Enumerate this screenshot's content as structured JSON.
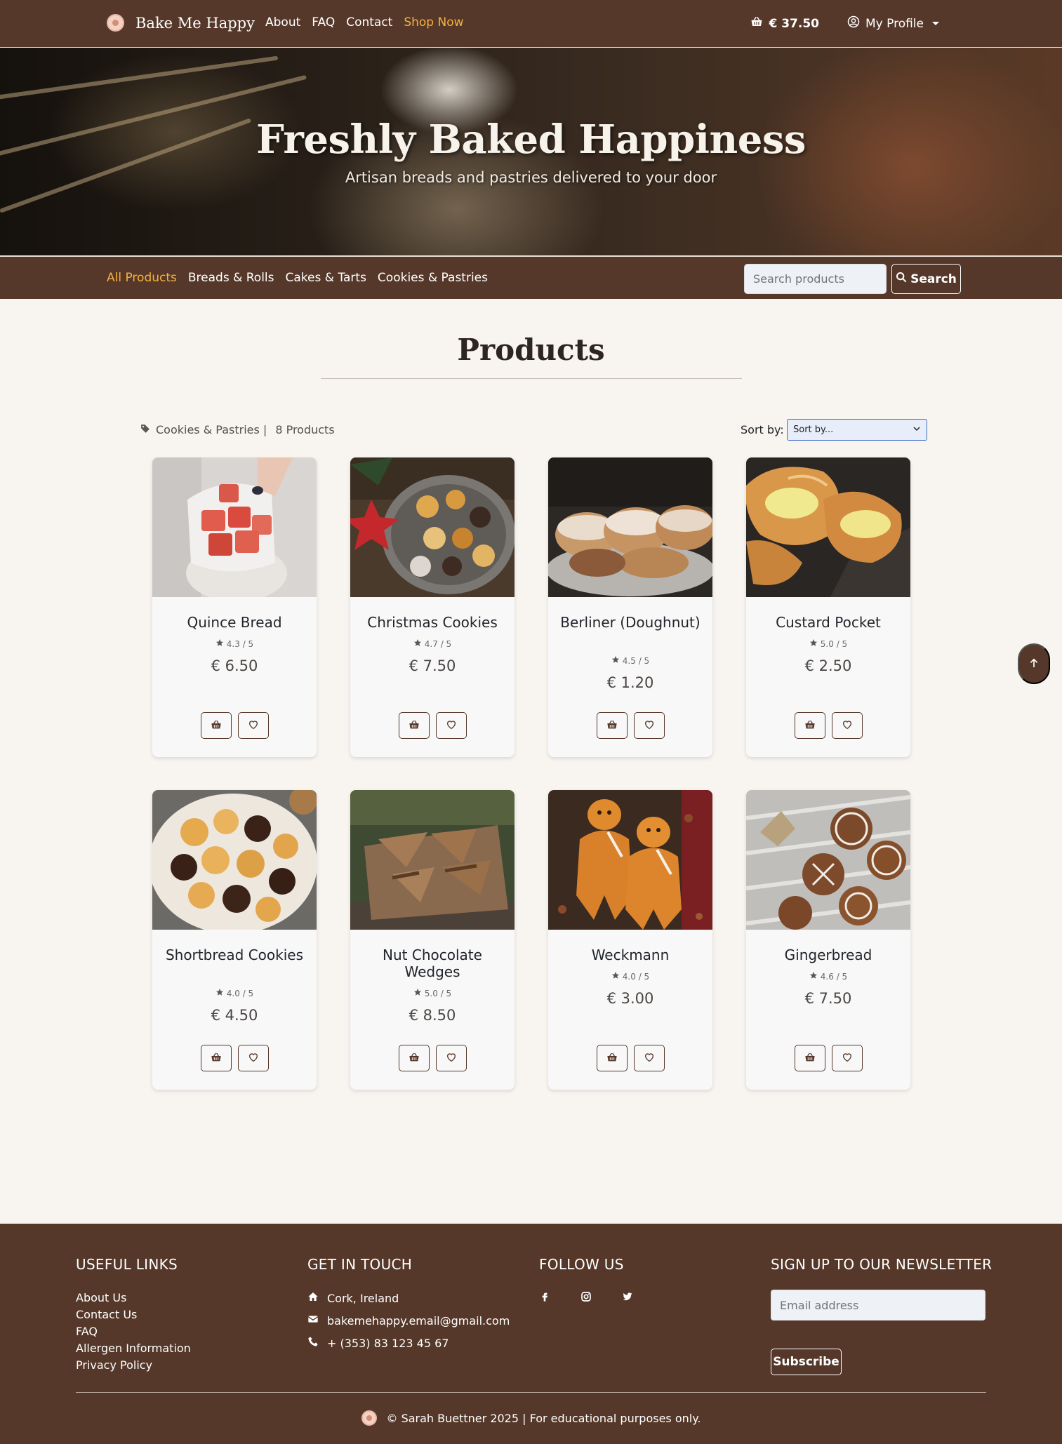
{
  "nav": {
    "brand": "Bake Me Happy",
    "links": [
      {
        "label": "About"
      },
      {
        "label": "FAQ"
      },
      {
        "label": "Contact"
      },
      {
        "label": "Shop Now",
        "active": true
      }
    ],
    "cart_total": "€ 37.50",
    "profile_label": "My Profile"
  },
  "hero": {
    "title": "Freshly Baked Happiness",
    "subtitle": "Artisan breads and pastries delivered to your door"
  },
  "categories": {
    "items": [
      {
        "label": "All Products",
        "active": true
      },
      {
        "label": "Breads & Rolls"
      },
      {
        "label": "Cakes & Tarts"
      },
      {
        "label": "Cookies & Pastries"
      }
    ],
    "search_placeholder": "Search products",
    "search_button": "Search"
  },
  "products_section": {
    "title": "Products",
    "filter_category": "Cookies & Pastries |",
    "count": "8 Products",
    "sort_label": "Sort by:",
    "sort_value": "Sort by..."
  },
  "products": [
    {
      "name": "Quince Bread",
      "rating": "4.3 / 5",
      "price": "€ 6.50",
      "image": "quince-bread-photo"
    },
    {
      "name": "Christmas Cookies",
      "rating": "4.7 / 5",
      "price": "€ 7.50",
      "image": "christmas-cookies-photo"
    },
    {
      "name": "Berliner (Doughnut)",
      "rating": "4.5 / 5",
      "price": "€ 1.20",
      "image": "berliner-photo"
    },
    {
      "name": "Custard Pocket",
      "rating": "5.0 / 5",
      "price": "€ 2.50",
      "image": "custard-pocket-photo"
    },
    {
      "name": "Shortbread Cookies",
      "rating": "4.0 / 5",
      "price": "€ 4.50",
      "image": "shortbread-cookies-photo"
    },
    {
      "name": "Nut Chocolate Wedges",
      "rating": "5.0 / 5",
      "price": "€ 8.50",
      "image": "nut-chocolate-wedges-photo"
    },
    {
      "name": "Weckmann",
      "rating": "4.0 / 5",
      "price": "€ 3.00",
      "image": "weckmann-photo"
    },
    {
      "name": "Gingerbread",
      "rating": "4.6 / 5",
      "price": "€ 7.50",
      "image": "gingerbread-photo"
    }
  ],
  "footer": {
    "useful_links": {
      "heading": "USEFUL LINKS",
      "items": [
        "About Us",
        "Contact Us",
        "FAQ",
        "Allergen Information",
        "Privacy Policy"
      ]
    },
    "contact": {
      "heading": "GET IN TOUCH",
      "location": "Cork, Ireland",
      "email": "bakemehappy.email@gmail.com",
      "phone": "+ (353) 83 123 45 67"
    },
    "follow": {
      "heading": "FOLLOW US",
      "icons": [
        "facebook-icon",
        "instagram-icon",
        "twitter-icon"
      ]
    },
    "newsletter": {
      "heading": "SIGN UP TO OUR NEWSLETTER",
      "email_placeholder": "Email address",
      "subscribe_button": "Subscribe"
    },
    "copyright": "© Sarah Buettner 2025 | For educational purposes only."
  },
  "colors": {
    "brand_brown": "#55382a",
    "accent_gold": "#f6b23e",
    "page_bg": "#f8f4ef"
  }
}
